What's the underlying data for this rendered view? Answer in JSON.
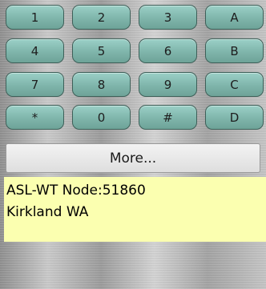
{
  "keypad": {
    "rows": [
      [
        "1",
        "2",
        "3",
        "A"
      ],
      [
        "4",
        "5",
        "6",
        "B"
      ],
      [
        "7",
        "8",
        "9",
        "C"
      ],
      [
        "*",
        "0",
        "#",
        "D"
      ]
    ]
  },
  "more_button": {
    "label": "More..."
  },
  "node_info": {
    "line1": "ASL-WT Node:51860",
    "line2": "Kirkland WA"
  }
}
